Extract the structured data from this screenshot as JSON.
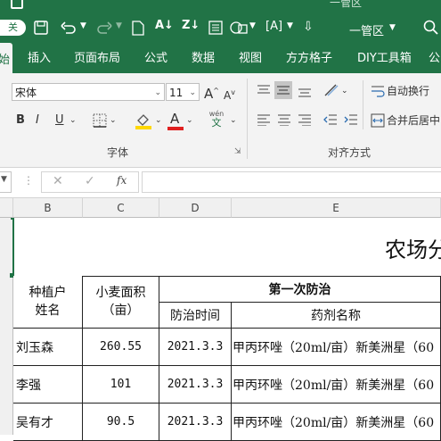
{
  "titlebar": {
    "app_name": "一管区",
    "autosave_label": "关"
  },
  "tabs": [
    "始",
    "插入",
    "页面布局",
    "公式",
    "数据",
    "视图",
    "方方格子",
    "DIY工具箱",
    "公"
  ],
  "ribbon": {
    "font_name": "宋体",
    "font_size": "11",
    "grow_font": "A",
    "shrink_font": "A",
    "bold": "B",
    "italic": "I",
    "underline": "U",
    "font_color_letter": "A",
    "phonetic_top": "wén",
    "phonetic_bottom": "文",
    "font_group_label": "字体",
    "wrap_text_label": "自动换行",
    "merge_center_label": "合并后居中",
    "alignment_group_label": "对齐方式",
    "accent_colors": {
      "fill": "#ffd800",
      "font": "#e02020",
      "green": "#217346"
    }
  },
  "formula_bar": {
    "cancel": "✕",
    "enter": "✓",
    "fx": "fx",
    "formula": ""
  },
  "columns": [
    "B",
    "C",
    "D",
    "E"
  ],
  "sheet": {
    "title_fragment": "农场分",
    "header_grower": "种植户\n姓名",
    "header_area": "小麦面积\n（亩）",
    "header_first_control": "第一次防治",
    "header_time": "防治时间",
    "header_agent": "药剂名称",
    "rows": [
      {
        "name": "刘玉森",
        "area": "260.55",
        "date": "2021.3.3",
        "agent": "甲丙环唑（20ml/亩）新美洲星（60"
      },
      {
        "name": "李强",
        "area": "101",
        "date": "2021.3.3",
        "agent": "甲丙环唑（20ml/亩）新美洲星（60"
      },
      {
        "name": "吴有才",
        "area": "90.5",
        "date": "2021.3.3",
        "agent": "甲丙环唑（20ml/亩）新美洲星（60"
      }
    ]
  }
}
